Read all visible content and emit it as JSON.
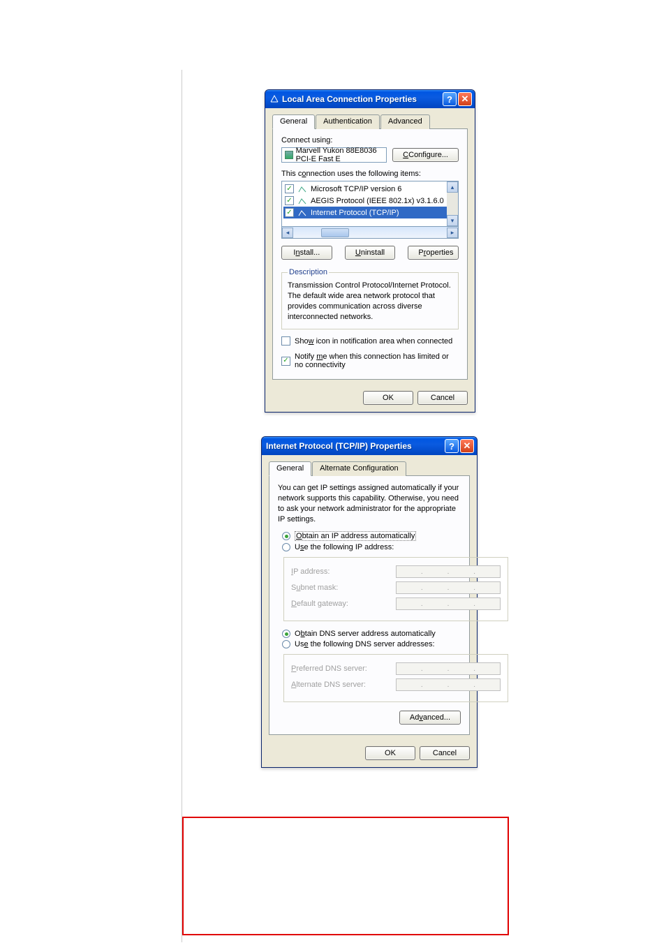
{
  "window1": {
    "title": "Local Area Connection Properties",
    "tabs": [
      "General",
      "Authentication",
      "Advanced"
    ],
    "connect_using_label": "Connect using:",
    "adapter_name": "Marvell Yukon 88E8036 PCI-E Fast E",
    "configure_btn": "Configure...",
    "items_label": "This connection uses the following items:",
    "items": [
      {
        "checked": true,
        "name": "Microsoft TCP/IP version 6"
      },
      {
        "checked": true,
        "name": "AEGIS Protocol (IEEE 802.1x) v3.1.6.0"
      },
      {
        "checked": true,
        "name": "Internet Protocol (TCP/IP)",
        "selected": true
      }
    ],
    "install_btn": "Install...",
    "uninstall_btn": "Uninstall",
    "properties_btn": "Properties",
    "description_heading": "Description",
    "description_text": "Transmission Control Protocol/Internet Protocol. The default wide area network protocol that provides communication across diverse interconnected networks.",
    "show_icon_label": "Show icon in notification area when connected",
    "show_icon_checked": false,
    "notify_label": "Notify me when this connection has limited or no connectivity",
    "notify_checked": true,
    "ok_btn": "OK",
    "cancel_btn": "Cancel"
  },
  "window2": {
    "title": "Internet Protocol (TCP/IP) Properties",
    "tabs": [
      "General",
      "Alternate Configuration"
    ],
    "intro": "You can get IP settings assigned automatically if your network supports this capability. Otherwise, you need to ask your network administrator for the appropriate IP settings.",
    "ip_auto_label": "Obtain an IP address automatically",
    "ip_manual_label": "Use the following IP address:",
    "ip_fields": {
      "ip_address_label": "IP address:",
      "subnet_label": "Subnet mask:",
      "gateway_label": "Default gateway:"
    },
    "dns_auto_label": "Obtain DNS server address automatically",
    "dns_manual_label": "Use the following DNS server addresses:",
    "dns_fields": {
      "pref_label": "Preferred DNS server:",
      "alt_label": "Alternate DNS server:"
    },
    "advanced_btn": "Advanced...",
    "ok_btn": "OK",
    "cancel_btn": "Cancel",
    "ip_selected": "auto",
    "dns_selected": "auto"
  }
}
